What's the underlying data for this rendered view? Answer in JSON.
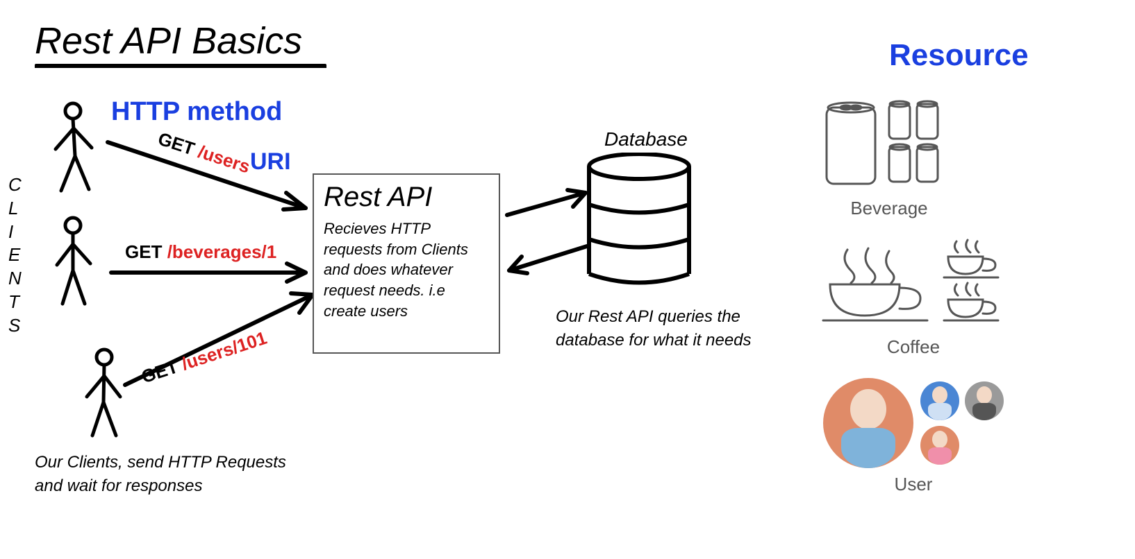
{
  "title": "Rest API Basics",
  "labels": {
    "http_method": "HTTP method",
    "uri": "URI",
    "clients_letters": [
      "C",
      "L",
      "I",
      "E",
      "N",
      "T",
      "S"
    ]
  },
  "requests": [
    {
      "method": "GET",
      "path": "/users"
    },
    {
      "method": "GET",
      "path": "/beverages/1"
    },
    {
      "method": "GET",
      "path": "/users/101"
    }
  ],
  "rest_box": {
    "title": "Rest API",
    "desc": "Recieves HTTP requests from Clients and does whatever request needs. i.e create users"
  },
  "database": {
    "label": "Database",
    "caption": "Our Rest API queries the database for what it needs"
  },
  "clients_caption": "Our Clients, send HTTP Requests and wait for responses",
  "resource": {
    "title": "Resource",
    "items": [
      {
        "name": "Beverage"
      },
      {
        "name": "Coffee"
      },
      {
        "name": "User"
      }
    ]
  }
}
